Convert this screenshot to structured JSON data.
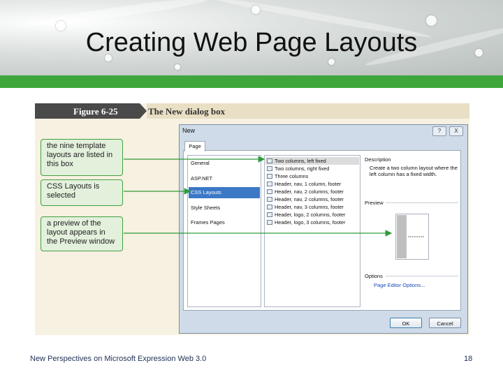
{
  "slide": {
    "title": "Creating Web Page Layouts",
    "footer": "New Perspectives on Microsoft Expression Web 3.0",
    "page_number": "18"
  },
  "figure": {
    "number": "Figure 6-25",
    "caption": "The New dialog box"
  },
  "callouts": [
    "the nine template layouts are listed in this box",
    "CSS Layouts is selected",
    "a preview of the layout appears in the Preview window"
  ],
  "dialog": {
    "title": "New",
    "help_button": "?",
    "close_button": "X",
    "tab": "Page",
    "categories": [
      "General",
      "ASP.NET",
      "CSS Layouts",
      "Style Sheets",
      "Frames Pages"
    ],
    "selected_category": "CSS Layouts",
    "layouts": [
      "Two columns, left fixed",
      "Two columns, right fixed",
      "Three columns",
      "Header, nav, 1 column, footer",
      "Header, nav, 2 columns, footer",
      "Header, nav, 2 columns, footer",
      "Header, nav, 3 columns, footer",
      "Header, logo, 2 columns, footer",
      "Header, logo, 3 columns, footer"
    ],
    "selected_layout": "Two columns, left fixed",
    "description_label": "Description",
    "description_text": "Create a two column layout where the left column has a fixed width.",
    "preview_label": "Preview",
    "options_label": "Options",
    "options_link": "Page Editor Options...",
    "ok_label": "OK",
    "cancel_label": "Cancel"
  },
  "colors": {
    "accent_green": "#3fa63c",
    "selection_blue": "#3b78c6",
    "callout_fill": "#e3f0dc"
  }
}
